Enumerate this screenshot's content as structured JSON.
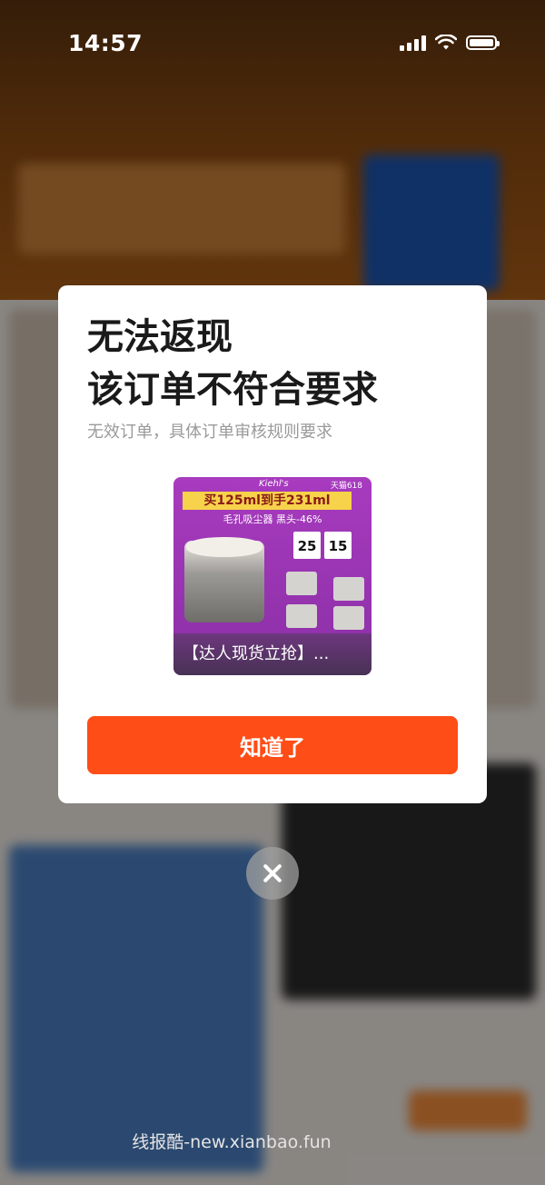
{
  "status_bar": {
    "time": "14:57"
  },
  "dialog": {
    "title_line1": "无法返现",
    "title_line2": "该订单不符合要求",
    "subtitle": "无效订单，具体订单审核规则要求",
    "product": {
      "brand": "Kiehl's",
      "tag": "天猫618",
      "banner": "买125ml到手231ml",
      "promo_line": "毛孔吸尘器 黑头-46%",
      "price_a": "25",
      "price_b": "15",
      "caption": "【达人现货立抢】..."
    },
    "confirm_label": "知道了"
  },
  "close": {
    "icon": "close-icon"
  },
  "watermark": "线报酷-new.xianbao.fun",
  "colors": {
    "accent": "#ff4d17",
    "dialog_bg": "#ffffff",
    "title": "#1a1a1a",
    "subtitle": "#9a9a9a"
  }
}
